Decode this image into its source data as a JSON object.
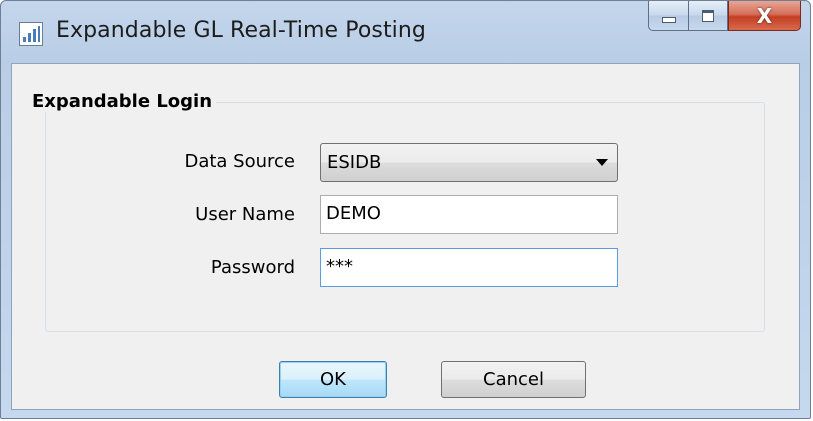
{
  "window": {
    "title": "Expandable GL Real-Time Posting",
    "icon": "app-chart-icon"
  },
  "caption_buttons": {
    "minimize": "minimize-icon",
    "maximize": "maximize-icon",
    "close_glyph": "X"
  },
  "login_group": {
    "title": "Expandable Login",
    "data_source": {
      "label": "Data Source",
      "value": "ESIDB"
    },
    "user_name": {
      "label": "User Name",
      "value": "DEMO"
    },
    "password": {
      "label": "Password",
      "value": "***"
    }
  },
  "buttons": {
    "ok": "OK",
    "cancel": "Cancel"
  },
  "colors": {
    "window_frame": "#c3d6ec",
    "close_button": "#c33f22",
    "focus_border": "#569de5",
    "default_button": "#3c7fb1"
  }
}
